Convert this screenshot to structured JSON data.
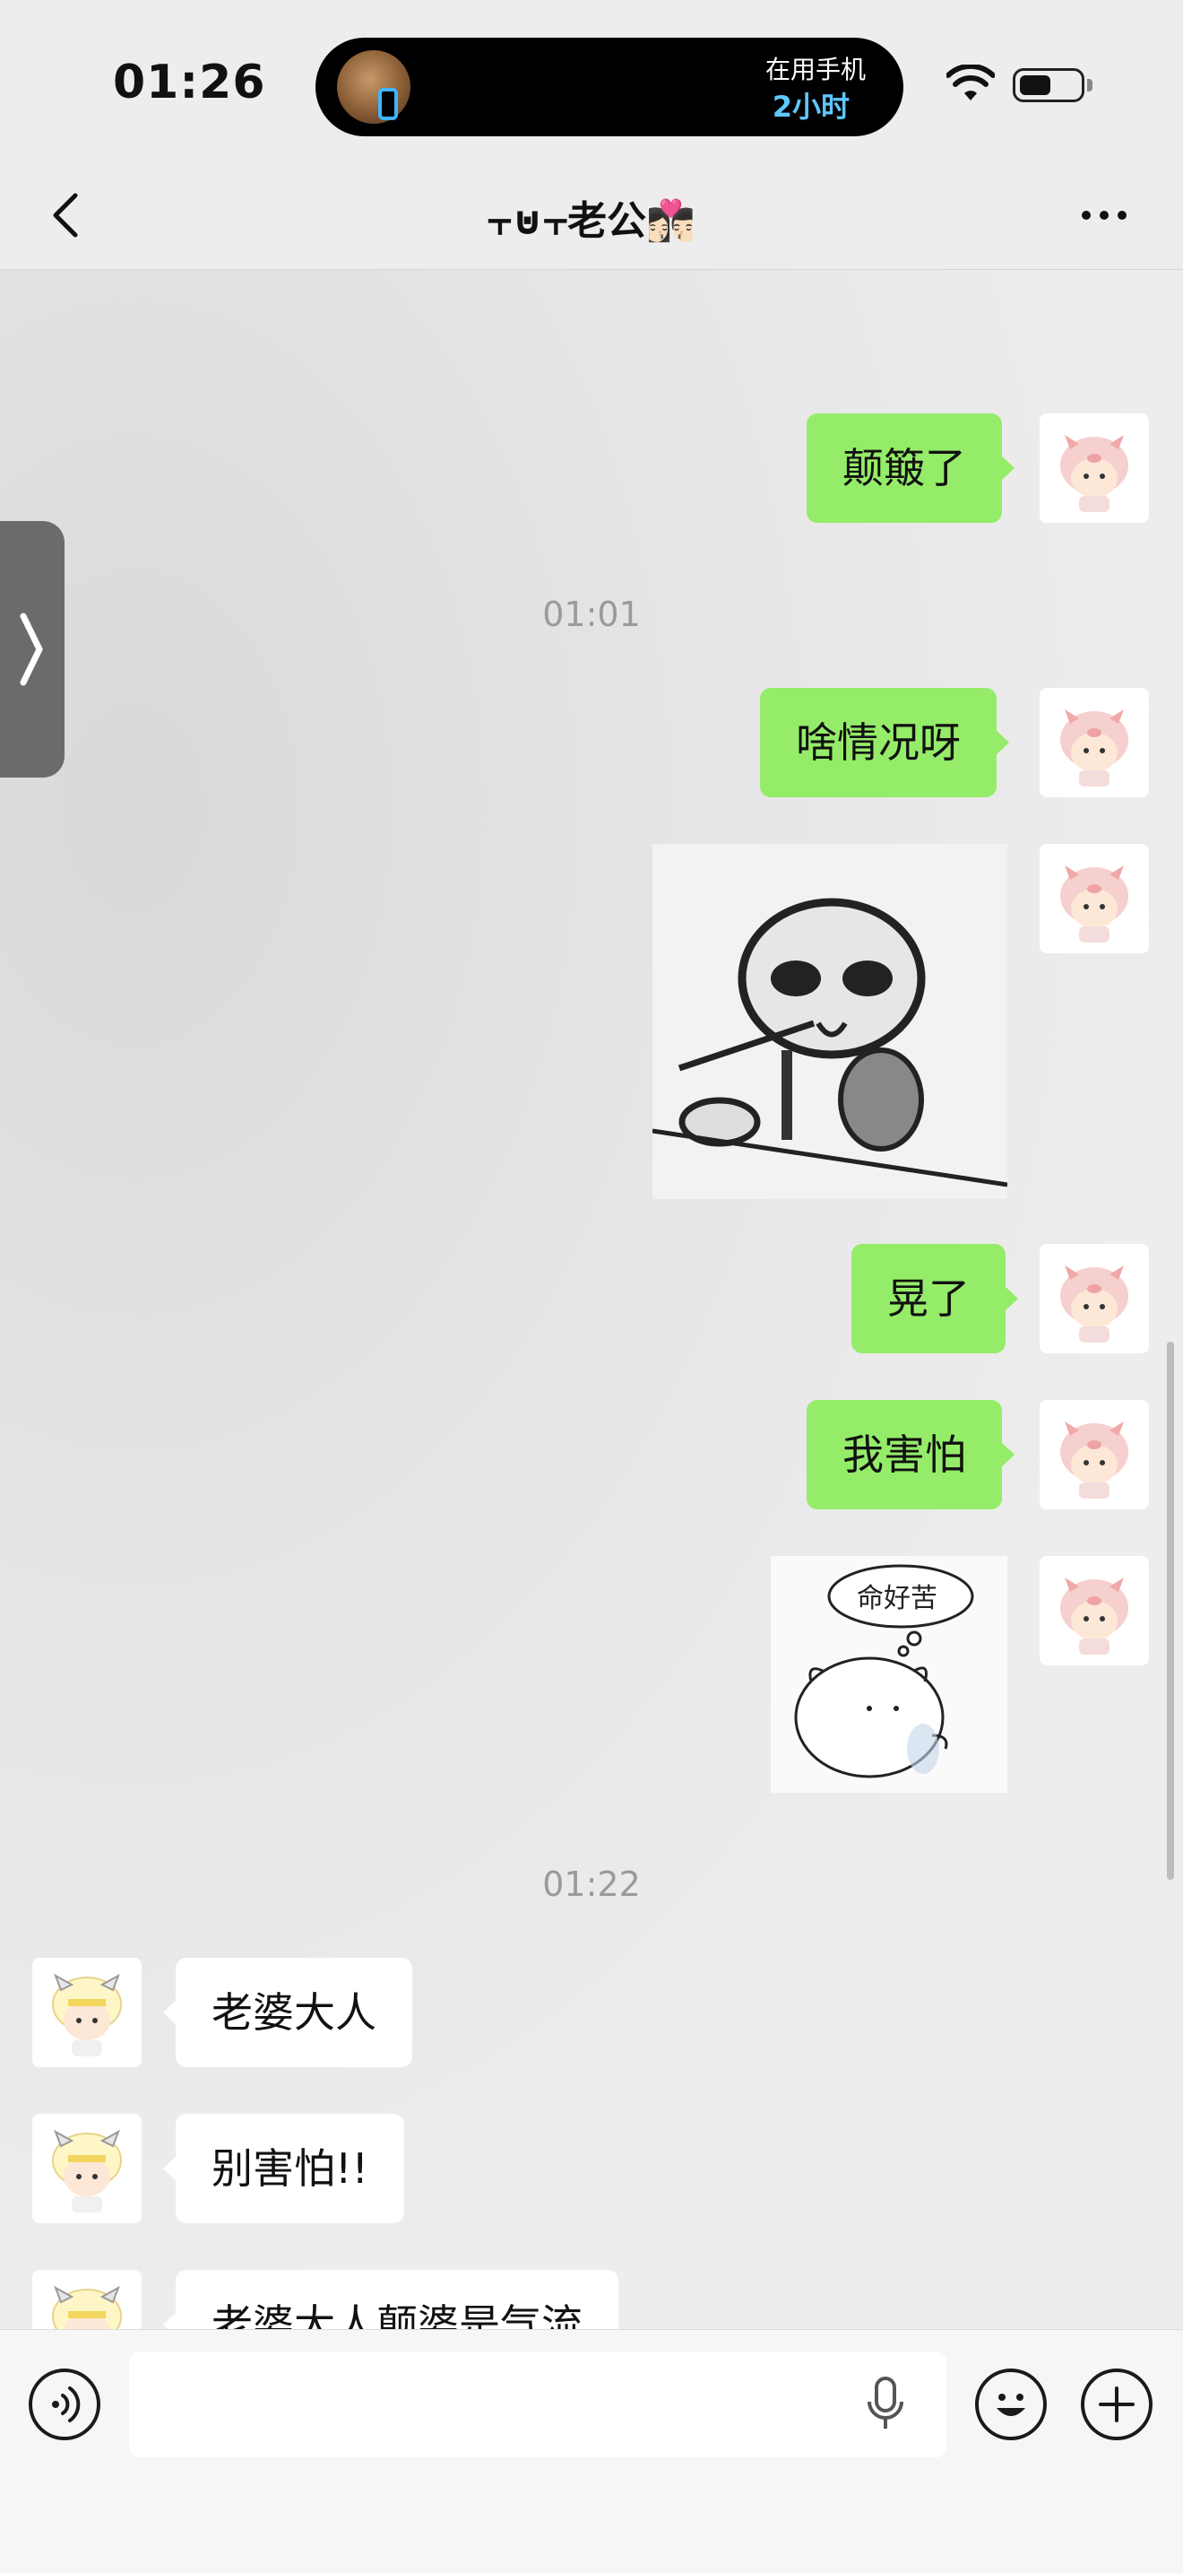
{
  "status_bar": {
    "time": "01:26",
    "island_label": "在用手机",
    "island_value": "2小时"
  },
  "nav": {
    "title": "⫟⊍⫟老公👩🏻‍❤️‍💋‍👨🏻"
  },
  "messages": [
    {
      "type": "text",
      "side": "out",
      "text": "颠簸了"
    },
    {
      "type": "time",
      "text": "01:01"
    },
    {
      "type": "text",
      "side": "out",
      "text": "啥情况呀"
    },
    {
      "type": "sticker",
      "side": "out",
      "sticker": "panicked-cartoon-figure"
    },
    {
      "type": "text",
      "side": "out",
      "text": "晃了"
    },
    {
      "type": "text",
      "side": "out",
      "text": "我害怕"
    },
    {
      "type": "sticker",
      "side": "out",
      "sticker": "sad-hamster",
      "caption": "命好苦"
    },
    {
      "type": "time",
      "text": "01:22"
    },
    {
      "type": "text",
      "side": "in",
      "text": "老婆大人"
    },
    {
      "type": "text",
      "side": "in",
      "text": "别害怕!!"
    },
    {
      "type": "text",
      "side": "in",
      "text": "老婆大人颠婆是气流"
    }
  ],
  "input_bar": {
    "placeholder": "",
    "voice_icon": "voice-toggle-icon",
    "mic_icon": "microphone-icon",
    "emoji_icon": "emoji-icon",
    "plus_icon": "plus-icon"
  }
}
